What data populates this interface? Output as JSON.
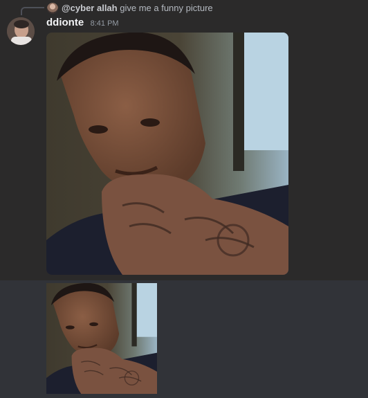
{
  "reply": {
    "username": "@cyber allah",
    "content": "give me a funny picture"
  },
  "message": {
    "author": "ddionte",
    "timestamp": "8:41 PM"
  },
  "attachments": [
    {
      "subject": "selfie-photo"
    },
    {
      "subject": "selfie-photo"
    }
  ],
  "colors": {
    "background": "#313338",
    "highlight": "#2b2a2a",
    "username": "#f2f3f5",
    "timestamp": "#949ba4"
  }
}
